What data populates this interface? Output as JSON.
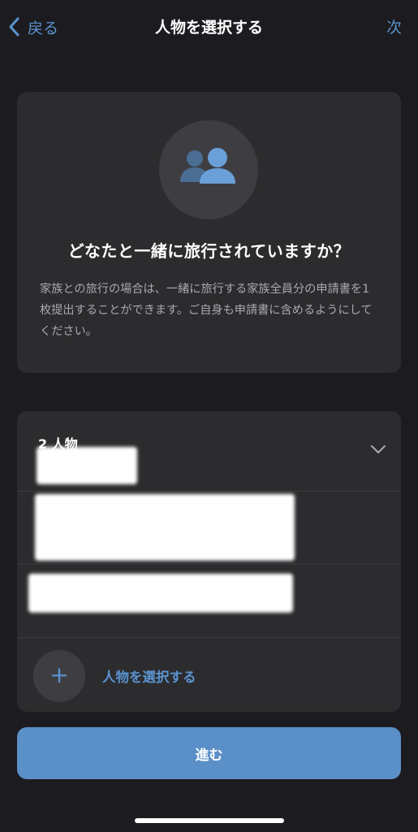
{
  "nav": {
    "back_label": "戻る",
    "title": "人物を選択する",
    "next_label": "次"
  },
  "info": {
    "heading": "どなたと一緒に旅行されていますか？",
    "description": "家族との旅行の場合は、一緒に旅行する家族全員分の申請書を1枚提出することができます。ご自身も申請書に含めるようにしてください。"
  },
  "people": {
    "count_label": "2 人物",
    "add_label": "人物を選択する"
  },
  "proceed_label": "進む",
  "colors": {
    "background": "#1c1b1f",
    "card": "#2c2c2e",
    "accent": "#5a93cf",
    "button": "#5a8fc8"
  },
  "icons": {
    "back": "chevron-left-icon",
    "people": "people-icon",
    "expand": "chevron-down-icon",
    "add": "plus-icon"
  }
}
